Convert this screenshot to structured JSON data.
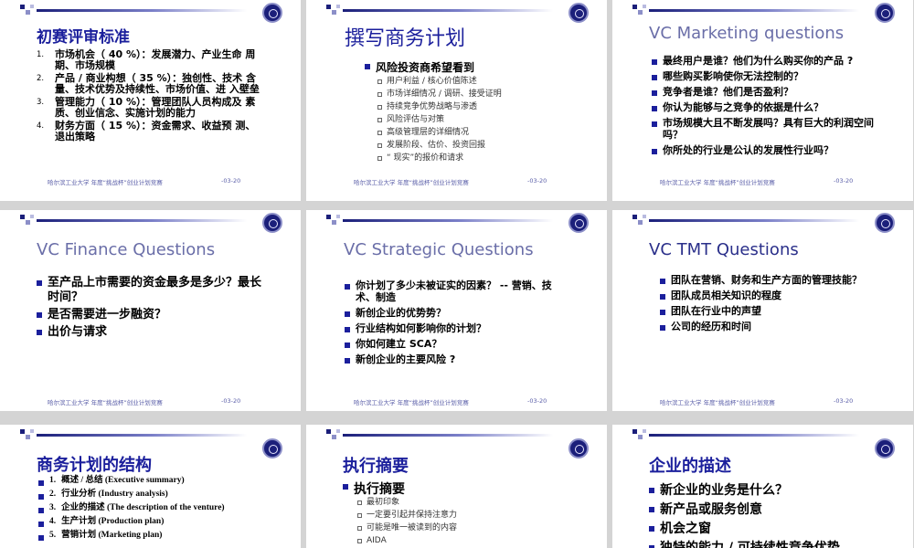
{
  "common": {
    "footer_org": "哈尔滨工业大学 年度“挑战杯”创业计划竞赛",
    "footer_date": "-03-20"
  },
  "s1": {
    "title": "初赛评审标准",
    "items": [
      {
        "n": "1.",
        "text": "市场机会（ 40 %）：发展潜力、产业生命 周期、市场规模"
      },
      {
        "n": "2.",
        "text": "产品 / 商业构想（ 35 %）：独创性、技术 含量、技术优势及持续性、市场价值、进 入壁垒"
      },
      {
        "n": "3.",
        "text": "管理能力（ 10 %）：管理团队人员构成及 素质、创业信念、实施计划的能力"
      },
      {
        "n": "4.",
        "text": "财务方面（ 15 %）：资金需求、收益预 测、退出策略"
      }
    ]
  },
  "s2": {
    "title": "撰写商务计划",
    "heading": "风险投资商希望看到",
    "items": [
      "用户利益 / 核心价值陈述",
      "市场详细情况 / 调研、接受证明",
      "持续竞争优势战略与渗透",
      "风险评估与对策",
      "高级管理层的详细情况",
      "发展阶段、估价、投资回报",
      "“ 现实”的报价和请求"
    ]
  },
  "s3": {
    "title": "VC Marketing questions",
    "items": [
      "最终用户是谁？他们为什么购买你的产品 ?",
      "哪些购买影响使你无法控制的？",
      "竞争者是谁？他们是否盈利？",
      "你认为能够与之竞争的依据是什么？",
      "市场规模大且不断发展吗？具有巨大的利润空间吗？",
      "你所处的行业是公认的发展性行业吗？"
    ]
  },
  "s4": {
    "title": "VC Finance Questions",
    "items": [
      "至产品上市需要的资金最多是多少？最长时间？",
      "是否需要进一步融资？",
      "出价与请求"
    ]
  },
  "s5": {
    "title": "VC Strategic Questions",
    "items": [
      "你计划了多少未被证实的因素？ -- 营销、技 术、制造",
      "新创企业的优势势？",
      "行业结构如何影响你的计划？",
      "你如何建立 SCA？",
      "新创企业的主要风险 ?"
    ]
  },
  "s6": {
    "title": "VC TMT Questions",
    "items": [
      "团队在营销、财务和生产方面的管理技能？",
      "团队成员相关知识的程度",
      "团队在行业中的声望",
      "公司的经历和时间"
    ]
  },
  "s7": {
    "title": "商务计划的结构",
    "items": [
      {
        "n": "1.",
        "text": "概述 / 总结 (Executive summary)"
      },
      {
        "n": "2.",
        "text": "行业分析 (Industry analysis)"
      },
      {
        "n": "3.",
        "text": "企业的描述 (The description of the venture)"
      },
      {
        "n": "4.",
        "text": "生产计划 (Production plan)"
      },
      {
        "n": "5.",
        "text": "营销计划 (Marketing plan)"
      }
    ]
  },
  "s8": {
    "title": "执行摘要",
    "heading": "执行摘要",
    "items": [
      "最初印象",
      "一定要引起并保持注意力",
      "可能是唯一被读到的内容",
      "AIDA"
    ]
  },
  "s9": {
    "title": "企业的描述",
    "items": [
      "新企业的业务是什么？",
      "新产品或服务创意",
      "机会之窗",
      "独特的能力 / 可持续性竞争优势"
    ]
  },
  "colors": {
    "title_blue": "#1b1f9c",
    "bullet_blue": "#1b1f9c",
    "background": "#d4d4d4"
  }
}
